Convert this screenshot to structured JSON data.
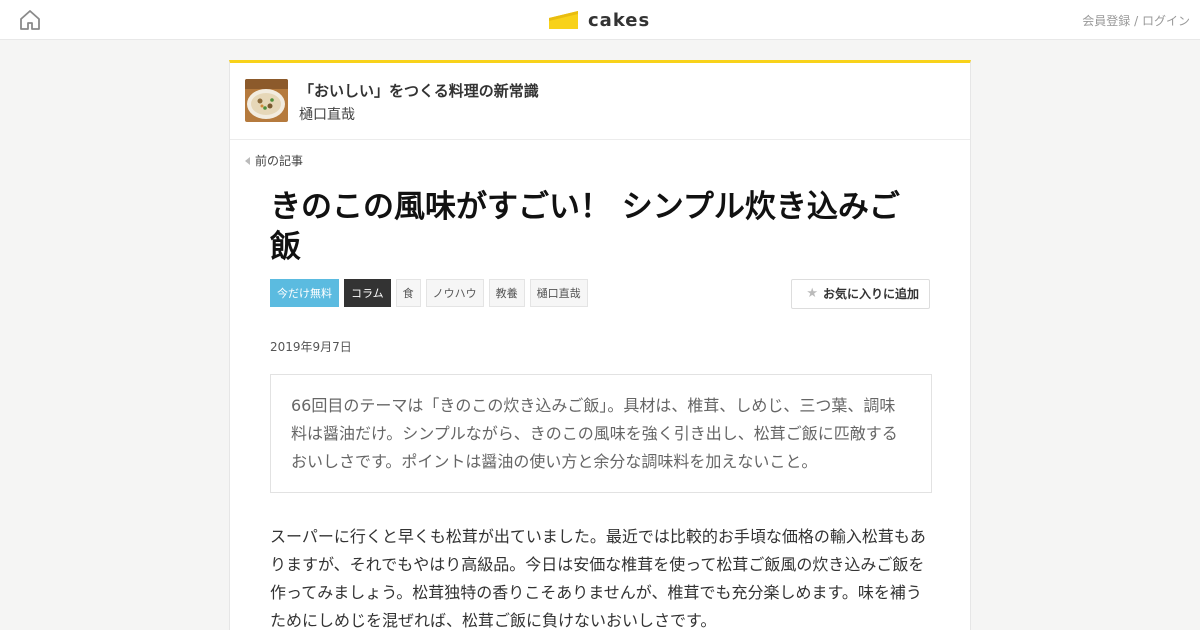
{
  "header": {
    "logo_text": "cakes",
    "auth_register": "会員登録",
    "auth_separator": " / ",
    "auth_login": "ログイン",
    "brand_color": "#f8d21a"
  },
  "series": {
    "title": "「おいしい」をつくる料理の新常識",
    "author": "樋口直哉"
  },
  "nav": {
    "prev_label": "前の記事"
  },
  "article": {
    "title": "きのこの風味がすごい！ シンプル炊き込みご飯",
    "tags": [
      "今だけ無料",
      "コラム",
      "食",
      "ノウハウ",
      "教養",
      "樋口直哉"
    ],
    "favorite_label": "お気に入りに追加",
    "date": "2019年9月7日",
    "lead": "66回目のテーマは「きのこの炊き込みご飯」。具材は、椎茸、しめじ、三つ葉、調味料は醤油だけ。シンプルながら、きのこの風味を強く引き出し、松茸ご飯に匹敵するおいしさです。ポイントは醤油の使い方と余分な調味料を加えないこと。",
    "body": "スーパーに行くと早くも松茸が出ていました。最近では比較的お手頃な価格の輸入松茸もありますが、それでもやはり高級品。今日は安価な椎茸を使って松茸ご飯風の炊き込みご飯を作ってみましょう。松茸独特の香りこそありませんが、椎茸でも充分楽しめます。味を補うためにしめじを混ぜれば、松茸ご飯に負けないおいしさです。"
  }
}
